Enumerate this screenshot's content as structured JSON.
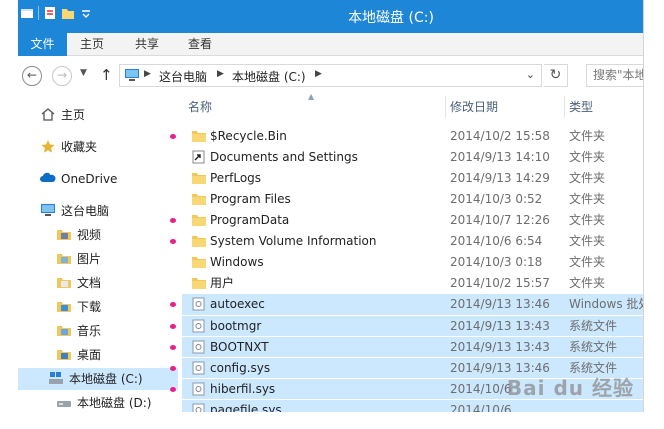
{
  "window": {
    "title": "本地磁盘 (C:)"
  },
  "ribbon": {
    "tabs": [
      "文件",
      "主页",
      "共享",
      "查看"
    ]
  },
  "address": {
    "crumbs": [
      "这台电脑",
      "本地磁盘 (C:)"
    ],
    "search_placeholder": "搜索\"本地"
  },
  "nav": {
    "items": [
      {
        "label": "主页",
        "icon": "home-icon"
      },
      {
        "label": "收藏夹",
        "icon": "star-icon"
      },
      {
        "label": "OneDrive",
        "icon": "cloud-icon"
      },
      {
        "label": "这台电脑",
        "icon": "computer-icon"
      },
      {
        "label": "视频",
        "icon": "video-folder-icon"
      },
      {
        "label": "图片",
        "icon": "pictures-folder-icon"
      },
      {
        "label": "文档",
        "icon": "documents-folder-icon"
      },
      {
        "label": "下载",
        "icon": "downloads-folder-icon"
      },
      {
        "label": "音乐",
        "icon": "music-folder-icon"
      },
      {
        "label": "桌面",
        "icon": "desktop-folder-icon"
      },
      {
        "label": "本地磁盘 (C:)",
        "icon": "drive-c-icon"
      },
      {
        "label": "本地磁盘 (D:)",
        "icon": "drive-d-icon"
      }
    ]
  },
  "columns": {
    "name": "名称",
    "date": "修改日期",
    "type": "类型"
  },
  "files": [
    {
      "name": "$Recycle.Bin",
      "date": "2014/10/2 15:58",
      "type": "文件夹",
      "icon": "folder-icon",
      "marked": true,
      "selected": false
    },
    {
      "name": "Documents and Settings",
      "date": "2014/9/13 14:10",
      "type": "文件夹",
      "icon": "shortcut-folder-icon",
      "marked": false,
      "selected": false
    },
    {
      "name": "PerfLogs",
      "date": "2014/9/13 14:29",
      "type": "文件夹",
      "icon": "folder-icon",
      "marked": false,
      "selected": false
    },
    {
      "name": "Program Files",
      "date": "2014/10/3 0:52",
      "type": "文件夹",
      "icon": "folder-icon",
      "marked": false,
      "selected": false
    },
    {
      "name": "ProgramData",
      "date": "2014/10/7 12:26",
      "type": "文件夹",
      "icon": "folder-icon",
      "marked": true,
      "selected": false
    },
    {
      "name": "System Volume Information",
      "date": "2014/10/6 6:54",
      "type": "文件夹",
      "icon": "folder-icon",
      "marked": true,
      "selected": false
    },
    {
      "name": "Windows",
      "date": "2014/10/3 0:18",
      "type": "文件夹",
      "icon": "folder-icon",
      "marked": false,
      "selected": false
    },
    {
      "name": "用户",
      "date": "2014/10/2 15:57",
      "type": "文件夹",
      "icon": "folder-icon",
      "marked": false,
      "selected": false
    },
    {
      "name": "autoexec",
      "date": "2014/9/13 13:46",
      "type": "Windows 批处",
      "icon": "batch-file-icon",
      "marked": true,
      "selected": true
    },
    {
      "name": "bootmgr",
      "date": "2014/9/13 13:43",
      "type": "系统文件",
      "icon": "system-file-icon",
      "marked": true,
      "selected": true
    },
    {
      "name": "BOOTNXT",
      "date": "2014/9/13 13:43",
      "type": "系统文件",
      "icon": "system-file-icon",
      "marked": true,
      "selected": true
    },
    {
      "name": "config.sys",
      "date": "2014/9/13 13:46",
      "type": "系统文件",
      "icon": "system-file-icon",
      "marked": true,
      "selected": true
    },
    {
      "name": "hiberfil.sys",
      "date": "2014/10/6",
      "type": "",
      "icon": "system-file-icon",
      "marked": true,
      "selected": true
    },
    {
      "name": "pagefile.sys",
      "date": "2014/10/6",
      "type": "",
      "icon": "system-file-icon",
      "marked": false,
      "selected": true
    }
  ],
  "watermark": "Bai du 经验"
}
